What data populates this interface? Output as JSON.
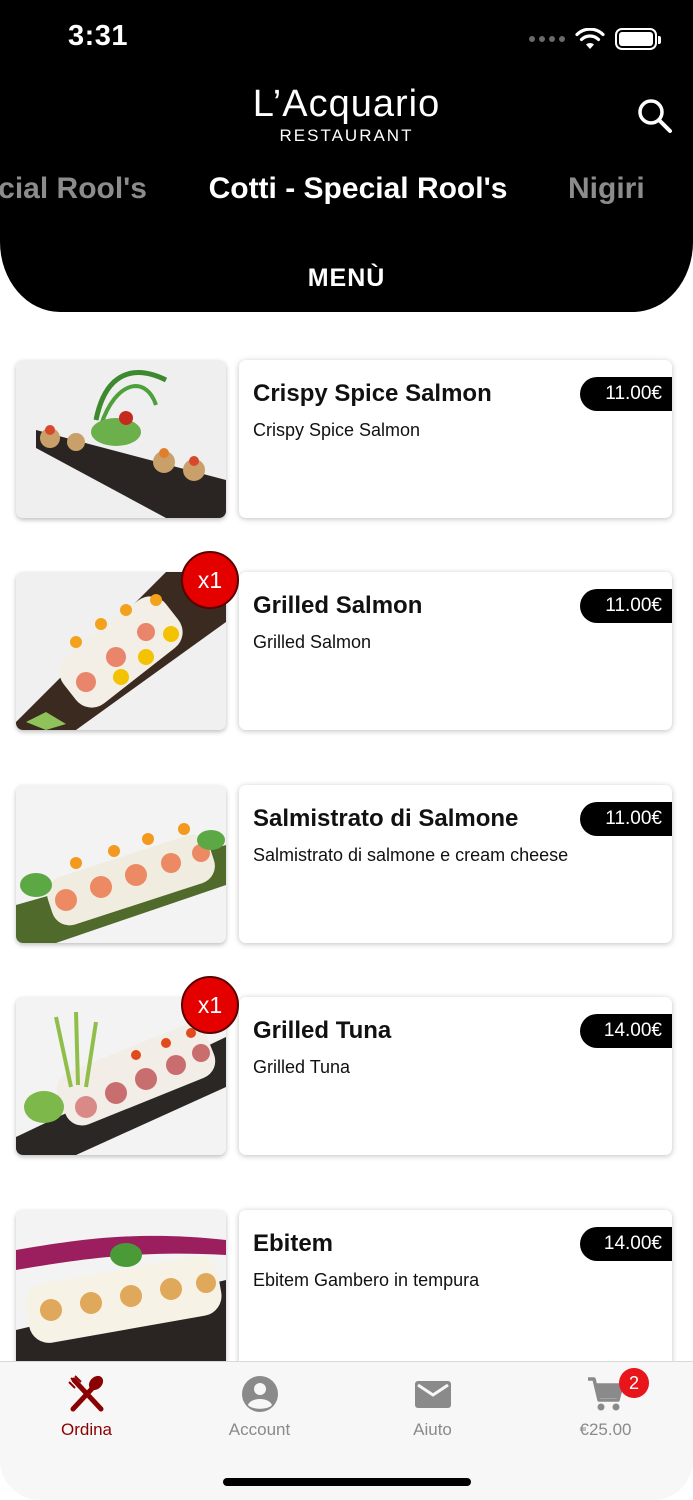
{
  "status": {
    "time": "3:31"
  },
  "brand": {
    "name": "L’Acquario",
    "subtitle": "RESTAURANT"
  },
  "categories": {
    "previous": "ecial Rool's",
    "active": "Cotti - Special Rool's",
    "next": "Nigiri"
  },
  "menu_label": "MENÙ",
  "items": [
    {
      "title": "Crispy Spice Salmon",
      "description": "Crispy Spice Salmon",
      "price": "11.00€",
      "quantity": ""
    },
    {
      "title": "Grilled Salmon",
      "description": "Grilled Salmon",
      "price": "11.00€",
      "quantity": "x1"
    },
    {
      "title": "Salmistrato di Salmone",
      "description": "Salmistrato di salmone e cream cheese",
      "price": "11.00€",
      "quantity": ""
    },
    {
      "title": "Grilled Tuna",
      "description": "Grilled Tuna",
      "price": "14.00€",
      "quantity": "x1"
    },
    {
      "title": "Ebitem",
      "description": "Ebitem Gambero in tempura",
      "price": "14.00€",
      "quantity": ""
    }
  ],
  "tabbar": {
    "order": "Ordina",
    "account": "Account",
    "help": "Aiuto",
    "cart_total": "€25.00",
    "cart_count": "2"
  },
  "icons": {
    "search": "search-icon",
    "order": "fork-knife-icon",
    "account": "user-circle-icon",
    "help": "envelope-icon",
    "cart": "cart-icon"
  },
  "colors": {
    "header": "#000000",
    "accent": "#8b0000",
    "badge": "#e50000",
    "inactive": "#8a8a8a"
  }
}
